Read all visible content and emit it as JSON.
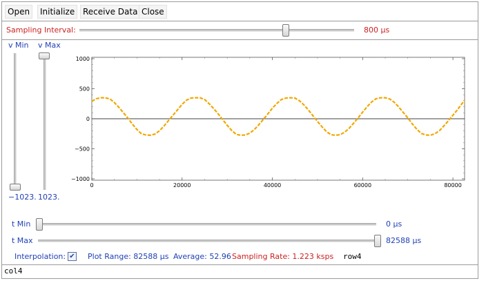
{
  "toolbar": {
    "open_label": "Open",
    "initialize_label": "Initialize",
    "receive_label": "Receive Data",
    "close_label": "Close"
  },
  "sampling": {
    "label": "Sampling Interval:",
    "value_text": "800 μs",
    "slider_fraction": 0.75
  },
  "v_sliders": {
    "min_label": "v Min",
    "max_label": "v Max",
    "min_value_text": "−1023.",
    "max_value_text": "1023."
  },
  "t_sliders": {
    "min_label": "t Min",
    "min_value_text": "0 μs",
    "max_label": "t Max",
    "max_value_text": "82588 μs"
  },
  "status": {
    "interpolation_label": "Interpolation:",
    "interpolation_checked": true,
    "check_glyph": "✔",
    "plot_range_text": "Plot Range: 82588 μs",
    "average_text": "Average: 52.96",
    "sampling_rate_text": "Sampling Rate: 1.223 ksps",
    "row_text": "row4",
    "col_text": "col4"
  },
  "colors": {
    "curve": "#f0a800",
    "red_text": "#cc1f1f",
    "blue_text": "#1f3fb5"
  },
  "chart_data": {
    "type": "line",
    "title": "",
    "xlabel": "",
    "ylabel": "",
    "xlim": [
      0,
      82588
    ],
    "ylim": [
      -1023,
      1023
    ],
    "x_ticks": [
      0,
      20000,
      40000,
      60000,
      80000
    ],
    "x_tick_labels": [
      "0",
      "20000",
      "40000",
      "60000",
      "80000"
    ],
    "y_ticks": [
      -1000,
      -500,
      0,
      500,
      1000
    ],
    "y_tick_labels": [
      "−1000",
      "−500",
      "0",
      "500",
      "1000"
    ],
    "series": [
      {
        "x": [
          0,
          1000,
          2000,
          3000,
          4000,
          5000,
          6000,
          7000,
          8000,
          9000,
          10000,
          11000,
          12000,
          13000,
          14000,
          15000,
          16000,
          17000,
          18000,
          19000,
          20000,
          21000,
          22000,
          23000,
          24000,
          25000,
          26000,
          27000,
          28000,
          29000,
          30000,
          31000,
          32000,
          33000,
          34000,
          35000,
          36000,
          37000,
          38000,
          39000,
          40000,
          41000,
          42000,
          43000,
          44000,
          45000,
          46000,
          47000,
          48000,
          49000,
          50000,
          51000,
          52000,
          53000,
          54000,
          55000,
          56000,
          57000,
          58000,
          59000,
          60000,
          61000,
          62000,
          63000,
          64000,
          65000,
          66000,
          67000,
          68000,
          69000,
          70000,
          71000,
          72000,
          73000,
          74000,
          75000,
          76000,
          77000,
          78000,
          79000,
          80000,
          81000,
          82588
        ],
        "y": [
          290,
          335,
          350,
          350,
          330,
          270,
          190,
          100,
          10,
          -90,
          -180,
          -250,
          -270,
          -275,
          -255,
          -200,
          -120,
          -30,
          60,
          150,
          240,
          310,
          345,
          350,
          350,
          320,
          250,
          170,
          80,
          -15,
          -110,
          -195,
          -260,
          -275,
          -270,
          -240,
          -180,
          -100,
          -10,
          80,
          175,
          255,
          320,
          345,
          350,
          345,
          300,
          230,
          145,
          50,
          -45,
          -135,
          -215,
          -265,
          -275,
          -265,
          -225,
          -160,
          -75,
          15,
          110,
          200,
          280,
          335,
          350,
          350,
          330,
          275,
          195,
          105,
          15,
          -85,
          -175,
          -245,
          -270,
          -275,
          -250,
          -200,
          -120,
          -35,
          60,
          150,
          310
        ]
      }
    ]
  }
}
